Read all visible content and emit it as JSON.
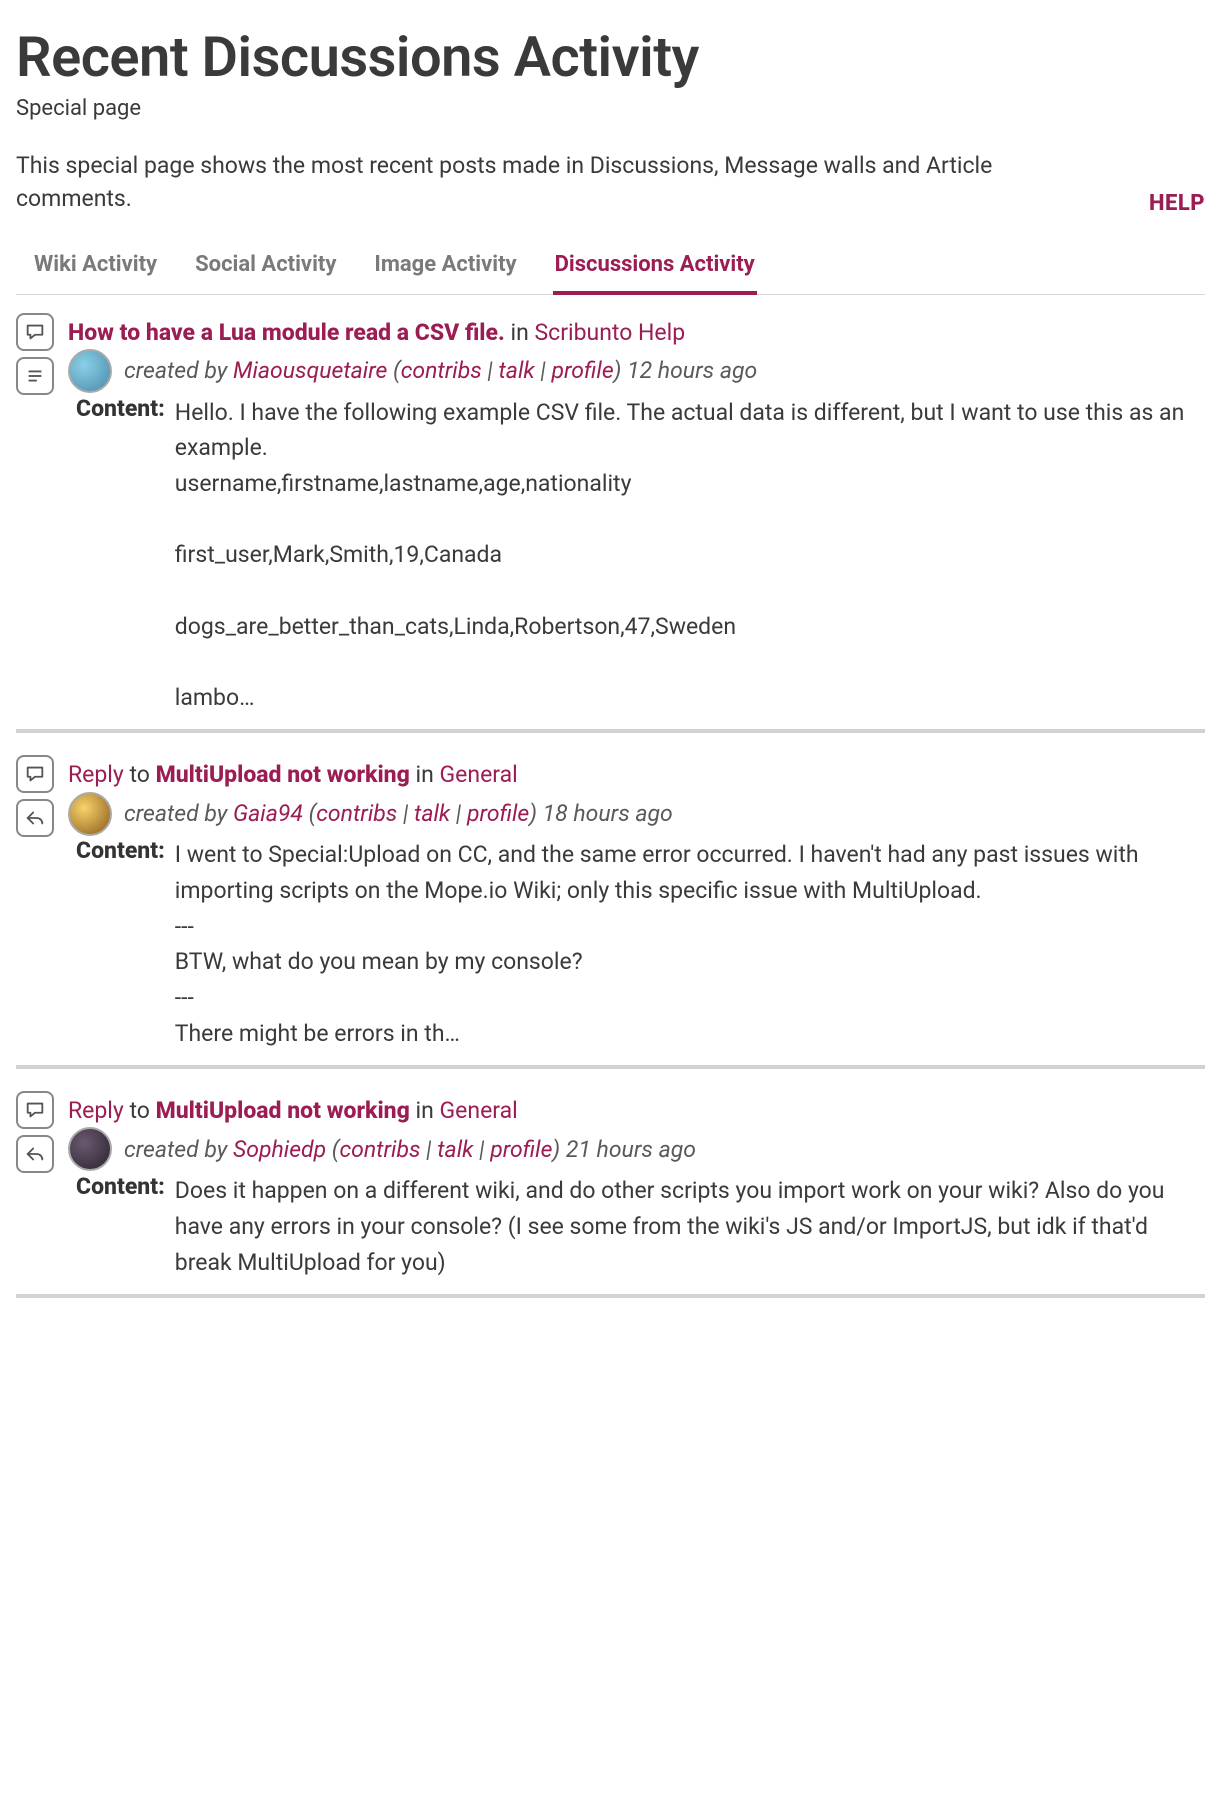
{
  "page": {
    "title": "Recent Discussions Activity",
    "subhead": "Special page",
    "intro": "This special page shows the most recent posts made in Discussions, Message walls and Article comments.",
    "help": "HELP"
  },
  "tabs": [
    {
      "label": "Wiki Activity",
      "active": false
    },
    {
      "label": "Social Activity",
      "active": false
    },
    {
      "label": "Image Activity",
      "active": false
    },
    {
      "label": "Discussions Activity",
      "active": true
    }
  ],
  "common": {
    "created_by": "created by",
    "contribs": "contribs",
    "talk": "talk",
    "profile": "profile",
    "content_label": "Content:",
    "reply_word": "Reply",
    "to_word": "to",
    "in_word": "in"
  },
  "items": [
    {
      "type": "post",
      "title": "How to have a Lua module read a CSV file.",
      "category": "Scribunto Help",
      "author": "Miaousquetaire",
      "time": "12 hours ago",
      "avatar": "blue",
      "secondary_icon": "text",
      "content": "Hello. I have the following example CSV file. The actual data is different, but I want to use this as an example.\nusername,firstname,lastname,age,nationality\n\nfirst_user,Mark,Smith,19,Canada\n\ndogs_are_better_than_cats,Linda,Robertson,47,Sweden\n\nlambo…"
    },
    {
      "type": "reply",
      "reply_to": "MultiUpload not working",
      "category": "General",
      "author": "Gaia94",
      "time": "18 hours ago",
      "avatar": "gold",
      "secondary_icon": "reply",
      "content": "I went to Special:Upload on CC, and the same error occurred. I haven't had any past issues with importing scripts on the Mope.io Wiki; only this specific issue with MultiUpload.\n---\nBTW, what do you mean by my console?\n---\nThere might be errors in th…"
    },
    {
      "type": "reply",
      "reply_to": "MultiUpload not working",
      "category": "General",
      "author": "Sophiedp",
      "time": "21 hours ago",
      "avatar": "dark",
      "secondary_icon": "reply",
      "content": "Does it happen on a different wiki, and do other scripts you import work on your wiki? Also do you have any errors in your console? (I see some from the wiki's JS and/or ImportJS, but idk if that'd break MultiUpload for you)"
    }
  ]
}
